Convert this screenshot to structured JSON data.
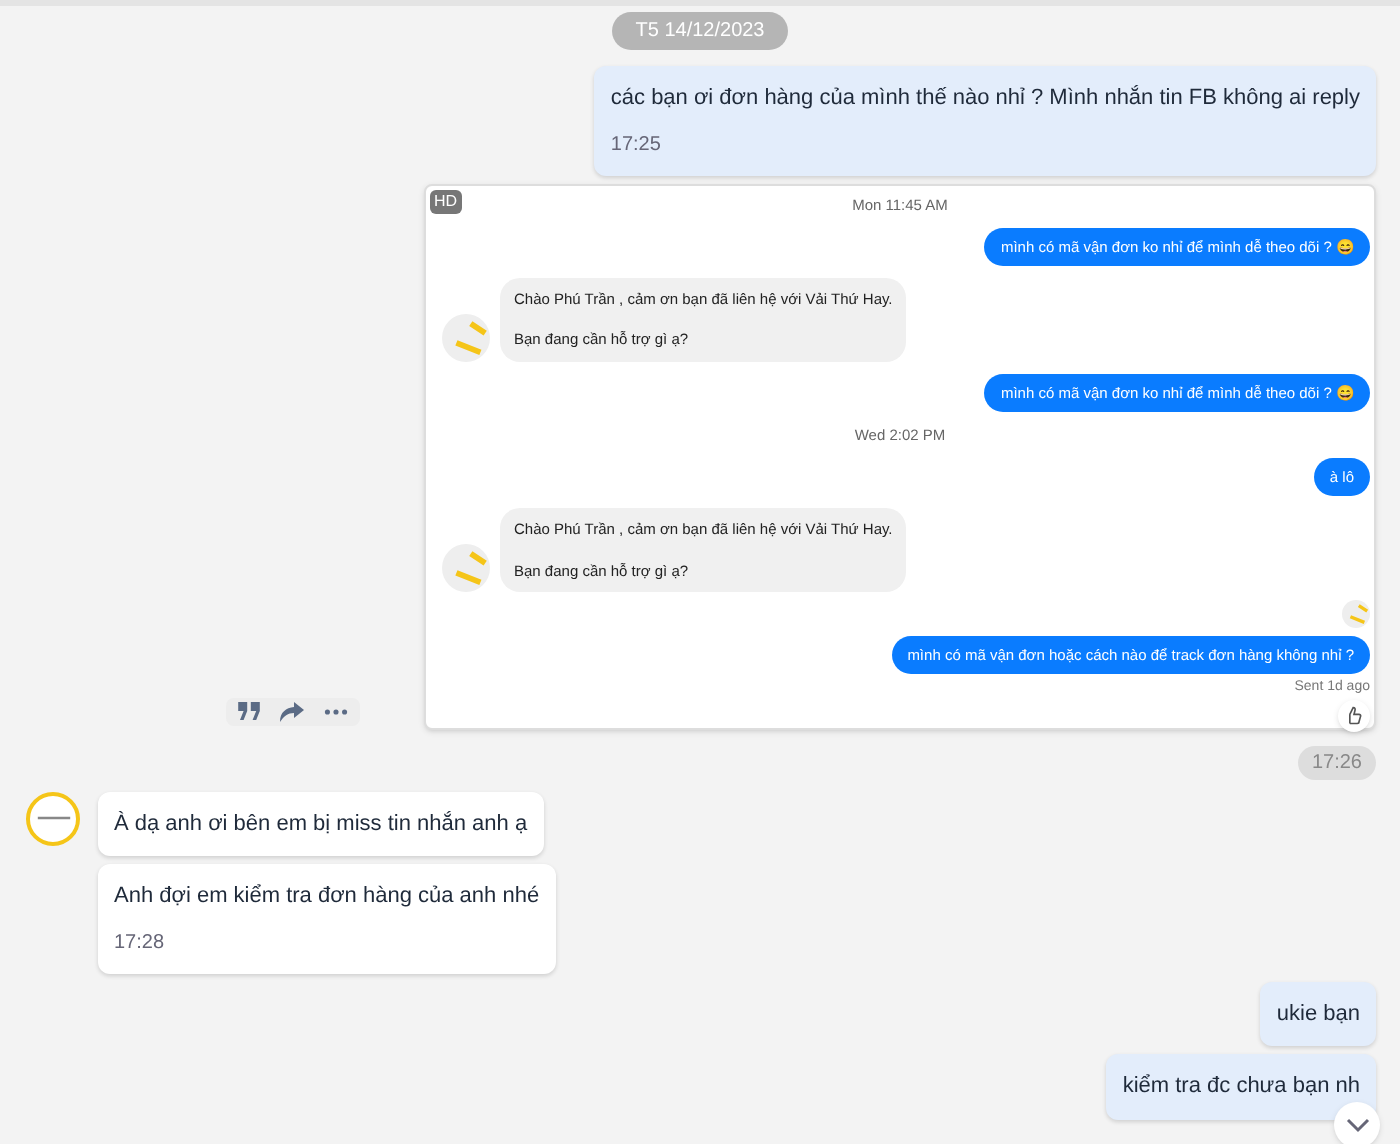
{
  "date_pill": "T5 14/12/2023",
  "messages": [
    {
      "kind": "outgoing",
      "text": "các bạn ơi đơn hàng của mình thế nào nhỉ ? Mình nhắn tin FB không ai reply",
      "time": "17:25"
    },
    {
      "kind": "screenshot",
      "badge": "HD",
      "actions": true,
      "items": [
        {
          "kind": "timestamp",
          "text": "Mon 11:45 AM"
        },
        {
          "kind": "sent",
          "text": "mình có mã vận đơn ko nhỉ để mình dễ theo dõi ? 😄"
        },
        {
          "kind": "received",
          "lines": [
            "Chào Phú Trần , cảm ơn bạn đã liên hệ với Vải Thứ Hay.",
            "Bạn đang cần hỗ trợ gì ạ?"
          ]
        },
        {
          "kind": "sent",
          "text": "mình có mã vận đơn ko nhỉ để mình dễ theo dõi ? 😄"
        },
        {
          "kind": "timestamp",
          "text": "Wed 2:02 PM"
        },
        {
          "kind": "sent",
          "text": "à lô"
        },
        {
          "kind": "received",
          "lines": [
            "Chào Phú Trần , cảm ơn bạn đã liên hệ với Vải Thứ Hay.",
            "Bạn đang cần hỗ trợ gì ạ?"
          ]
        },
        {
          "kind": "seen"
        },
        {
          "kind": "sent",
          "text": "mình có mã vận đơn hoặc cách nào để track đơn hàng không nhỉ ?"
        },
        {
          "kind": "status",
          "text": "Sent 1d ago"
        }
      ]
    },
    {
      "kind": "time_pill",
      "text": "17:26"
    },
    {
      "kind": "incoming",
      "avatar": true,
      "text": "À dạ anh ơi bên em bị miss tin nhắn anh ạ"
    },
    {
      "kind": "incoming",
      "avatar": false,
      "text": "Anh đợi em kiểm tra đơn hàng của anh nhé",
      "time": "17:28"
    },
    {
      "kind": "outgoing",
      "text": "ukie bạn"
    },
    {
      "kind": "outgoing",
      "text": "kiểm tra đc chưa bạn nh"
    }
  ]
}
